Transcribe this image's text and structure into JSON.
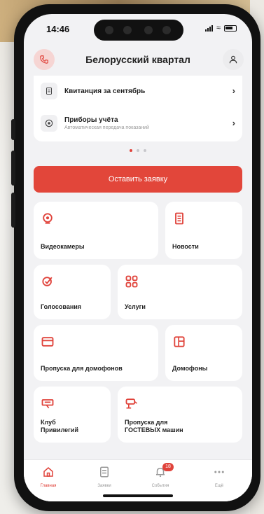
{
  "status_bar": {
    "time": "14:46"
  },
  "header": {
    "title": "Белорусский квартал",
    "left_icon": "phone-icon",
    "right_icon": "user-icon"
  },
  "top_card": {
    "rows": [
      {
        "title": "Квитанция за сентябрь",
        "subtitle": "",
        "icon": "receipt-icon"
      },
      {
        "title": "Приборы учёта",
        "subtitle": "Автоматическая передача показаний",
        "icon": "meter-icon"
      }
    ]
  },
  "pager": {
    "count": 3,
    "active": 1
  },
  "cta": {
    "label": "Оставить заявку"
  },
  "tiles": [
    {
      "label": "Видеокамеры",
      "icon": "camera-icon"
    },
    {
      "label": "Новости",
      "icon": "news-icon"
    },
    {
      "label": "Голосования",
      "icon": "vote-icon"
    },
    {
      "label": "Услуги",
      "icon": "services-icon"
    },
    {
      "label": "Пропуска для домофонов",
      "icon": "card-icon"
    },
    {
      "label": "Домофоны",
      "icon": "intercom-icon"
    },
    {
      "label": "Клуб\nПривилегий",
      "icon": "gift-icon"
    },
    {
      "label": "Пропуска для\nГОСТЕВЫХ машин",
      "icon": "car-icon"
    }
  ],
  "tabbar": {
    "items": [
      {
        "label": "Главная",
        "icon": "home-icon",
        "active": true
      },
      {
        "label": "Заявки",
        "icon": "requests-icon",
        "active": false
      },
      {
        "label": "События",
        "icon": "bell-icon",
        "active": false,
        "badge": "18"
      },
      {
        "label": "Ещё",
        "icon": "more-icon",
        "active": false
      }
    ]
  },
  "colors": {
    "accent": "#e2463a",
    "background": "#f2f2f4",
    "card": "#ffffff"
  }
}
